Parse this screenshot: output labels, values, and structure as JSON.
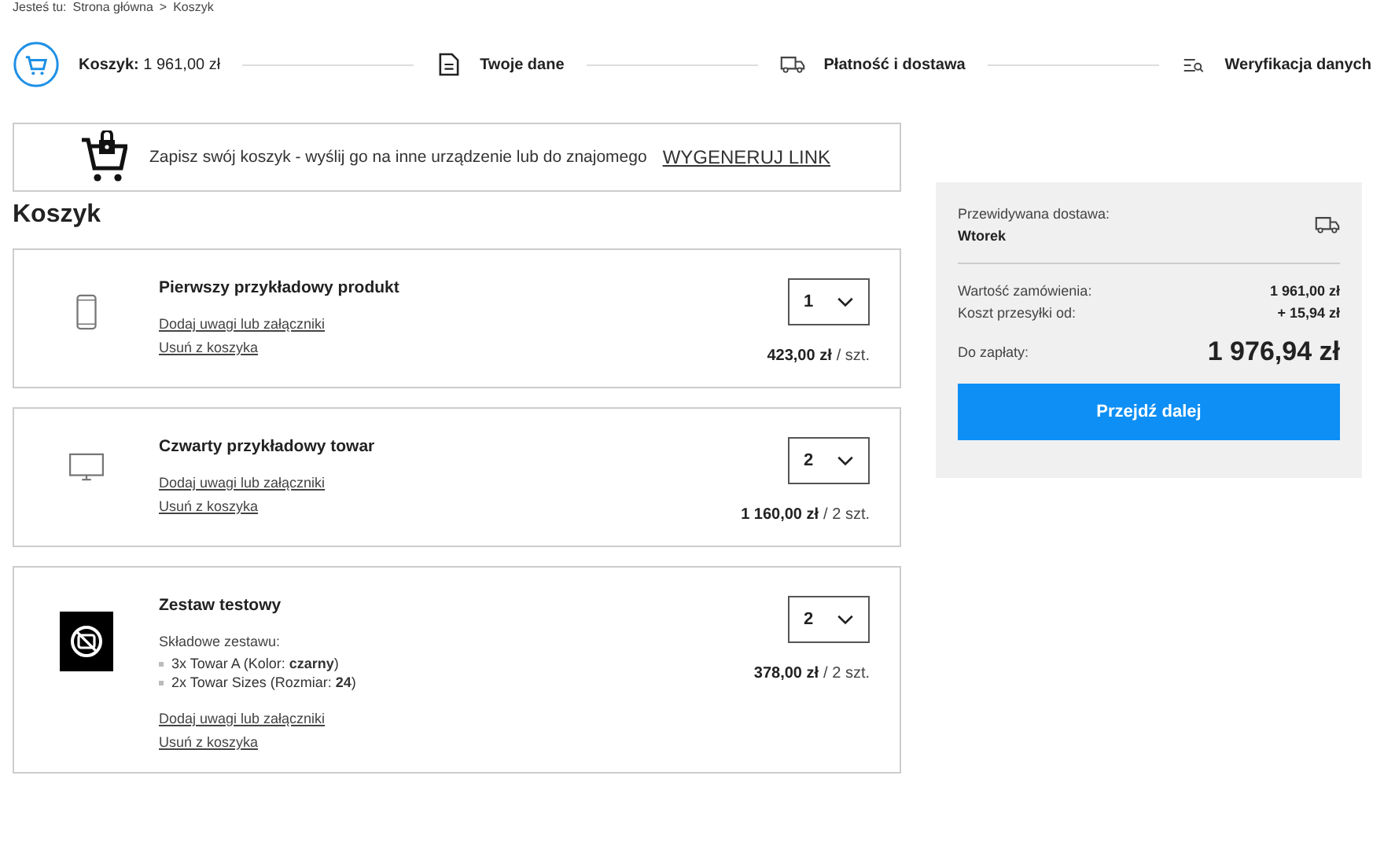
{
  "breadcrumb": {
    "label": "Jesteś tu:",
    "items": [
      "Strona główna",
      "Koszyk"
    ],
    "separator": ">"
  },
  "steps": [
    {
      "kind": "cart",
      "label": "Koszyk:",
      "value": "1 961,00 zł",
      "selected": true
    },
    {
      "kind": "document",
      "label": "Twoje dane",
      "selected": false
    },
    {
      "kind": "truck",
      "label": "Płatność i dostawa",
      "selected": false
    },
    {
      "kind": "verify",
      "label": "Weryfikacja danych",
      "selected": false
    }
  ],
  "save_banner": {
    "text": "Zapisz swój koszyk - wyślij go na inne urządzenie lub do znajomego",
    "link": "WYGENERUJ LINK"
  },
  "heading": "Koszyk",
  "items": [
    {
      "kind": "phone",
      "name": "Pierwszy przykładowy produkt",
      "notes_link": "Dodaj uwagi lub załączniki",
      "remove_link": "Usuń z koszyka",
      "quantity": "1",
      "price": "423,00 zł",
      "unit": "/ szt."
    },
    {
      "kind": "monitor",
      "name": "Czwarty przykładowy towar",
      "notes_link": "Dodaj uwagi lub załączniki",
      "remove_link": "Usuń z koszyka",
      "quantity": "2",
      "price": "1 160,00 zł",
      "unit": "/ 2 szt."
    },
    {
      "kind": "no-image",
      "name": "Zestaw testowy",
      "components_label": "Składowe zestawu:",
      "components": [
        "3x Towar A (Kolor: **czarny**)",
        "2x Towar Sizes (Rozmiar: **24**)"
      ],
      "notes_link": "Dodaj uwagi lub załączniki",
      "remove_link": "Usuń z koszyka",
      "quantity": "2",
      "price": "378,00 zł",
      "unit": "/ 2 szt."
    }
  ],
  "summary": {
    "delivery_label": "Przewidywana dostawa:",
    "delivery_day": "Wtorek",
    "rows": [
      {
        "label": "Wartość zamówienia:",
        "value": "1 961,00 zł"
      },
      {
        "label": "Koszt przesyłki od:",
        "value": "+ 15,94 zł"
      }
    ],
    "total_label": "Do zapłaty:",
    "total": "1 976,94 zł",
    "button": "Przejdź dalej"
  }
}
